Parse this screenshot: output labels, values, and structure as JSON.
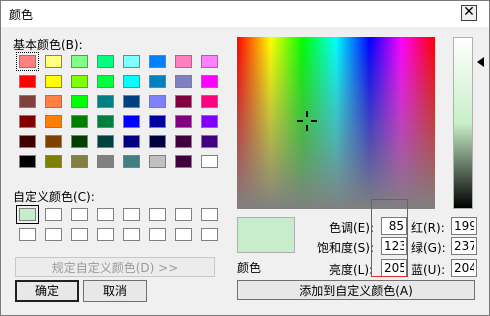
{
  "window": {
    "title": "颜色",
    "close_glyph": "✕"
  },
  "basic_colors": {
    "label": "基本颜色(B):",
    "swatches": [
      "#ff8080",
      "#ffff80",
      "#80ff80",
      "#00ff80",
      "#80ffff",
      "#0080ff",
      "#ff80c0",
      "#ff80ff",
      "#ff0000",
      "#ffff00",
      "#80ff00",
      "#00ff40",
      "#00ffff",
      "#0080c0",
      "#8080c0",
      "#ff00ff",
      "#804040",
      "#ff8040",
      "#00ff00",
      "#008080",
      "#004080",
      "#8080ff",
      "#800040",
      "#ff0080",
      "#800000",
      "#ff8000",
      "#008000",
      "#008040",
      "#0000ff",
      "#0000a0",
      "#800080",
      "#8000ff",
      "#400000",
      "#804000",
      "#004000",
      "#004040",
      "#000080",
      "#000040",
      "#400040",
      "#400080",
      "#000000",
      "#808000",
      "#808040",
      "#808080",
      "#408080",
      "#c0c0c0",
      "#400040",
      "#ffffff"
    ]
  },
  "custom_colors": {
    "label": "自定义颜色(C):",
    "swatches": [
      "#c7edcc",
      "#ffffff",
      "#ffffff",
      "#ffffff",
      "#ffffff",
      "#ffffff",
      "#ffffff",
      "#ffffff",
      "#ffffff",
      "#ffffff",
      "#ffffff",
      "#ffffff",
      "#ffffff",
      "#ffffff",
      "#ffffff",
      "#ffffff"
    ]
  },
  "define_custom_button": "规定自定义颜色(D) >>",
  "ok_button": "确定",
  "cancel_button": "取消",
  "preview_label": "颜色",
  "fields": {
    "hue": {
      "label": "色调(E):",
      "value": "85"
    },
    "sat": {
      "label": "饱和度(S):",
      "value": "123"
    },
    "lum": {
      "label": "亮度(L):",
      "value": "205"
    },
    "red": {
      "label": "红(R):",
      "value": "199"
    },
    "green": {
      "label": "绿(G):",
      "value": "237"
    },
    "blue": {
      "label": "蓝(U):",
      "value": "204"
    }
  },
  "add_custom_button": "添加到自定义颜色(A)"
}
